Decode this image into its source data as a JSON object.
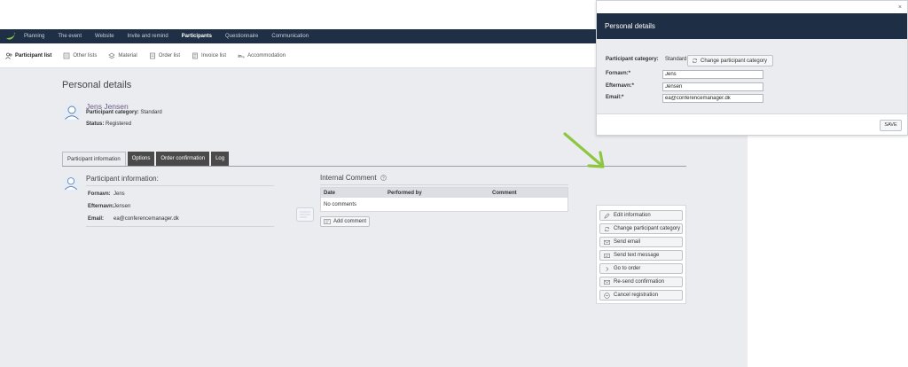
{
  "colors": {
    "nav_bg": "#1f2f45",
    "accent_green": "#8dc63f",
    "name_purple": "#6b5a8a",
    "page_bg": "#ebecf0"
  },
  "topnav": {
    "items": [
      "Planning",
      "The event",
      "Website",
      "Invite and remind",
      "Participants",
      "Questionnaire",
      "Communication"
    ],
    "active": "Participants"
  },
  "subnav": {
    "items": [
      {
        "label": "Participant list",
        "icon": "people-icon"
      },
      {
        "label": "Other lists",
        "icon": "list-icon"
      },
      {
        "label": "Material",
        "icon": "material-icon"
      },
      {
        "label": "Order list",
        "icon": "order-icon"
      },
      {
        "label": "Invoice list",
        "icon": "invoice-icon"
      },
      {
        "label": "Accommodation",
        "icon": "bed-icon"
      }
    ],
    "active": "Participant list"
  },
  "page": {
    "title": "Personal details",
    "participant_name": "Jens Jensen",
    "category_label": "Participant category:",
    "category_value": "Standard",
    "status_label": "Status:",
    "status_value": "Registered"
  },
  "tabs": [
    "Participant information",
    "Options",
    "Order confirmation",
    "Log"
  ],
  "participant_info": {
    "title": "Participant information:",
    "fields": [
      {
        "label": "Fornavn:",
        "value": "Jens"
      },
      {
        "label": "Efternavn:",
        "value": "Jensen"
      },
      {
        "label": "Email:",
        "value": "ea@conferencemanager.dk"
      }
    ]
  },
  "internal_comment": {
    "title": "Internal Comment",
    "columns": [
      "Date",
      "Performed by",
      "Comment"
    ],
    "empty_text": "No comments",
    "add_label": "Add comment"
  },
  "actions": [
    {
      "label": "Edit information",
      "icon": "pencil-icon"
    },
    {
      "label": "Change participant category",
      "icon": "refresh-icon"
    },
    {
      "label": "Send email",
      "icon": "envelope-icon"
    },
    {
      "label": "Send text message",
      "icon": "message-icon"
    },
    {
      "label": "Go to order",
      "icon": "arrow-right-icon"
    },
    {
      "label": "Re-send confirmation",
      "icon": "envelope-icon"
    },
    {
      "label": "Cancel registration",
      "icon": "minus-circle-icon"
    }
  ],
  "modal": {
    "close": "×",
    "title": "Personal details",
    "category_label": "Participant category:",
    "category_value": "Standard",
    "change_label": "Change participant category",
    "fields": [
      {
        "label": "Fornavn:*",
        "value": "Jens"
      },
      {
        "label": "Efternavn:*",
        "value": "Jensen"
      },
      {
        "label": "Email:*",
        "value": "ea@conferencemanager.dk"
      }
    ],
    "save_label": "SAVE"
  }
}
